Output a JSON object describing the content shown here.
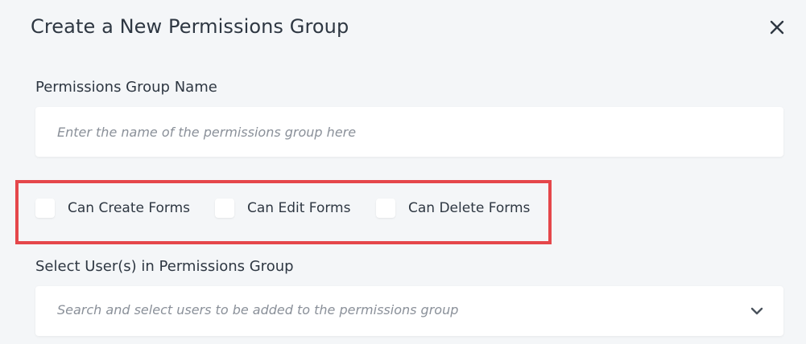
{
  "modal": {
    "title": "Create a New Permissions Group",
    "close_icon": "close-icon"
  },
  "group_name": {
    "label": "Permissions Group Name",
    "placeholder": "Enter the name of the permissions group here",
    "value": ""
  },
  "permissions": {
    "highlight_color": "#e5474b",
    "items": [
      {
        "label": "Can Create Forms",
        "checked": false
      },
      {
        "label": "Can Edit Forms",
        "checked": false
      },
      {
        "label": "Can Delete Forms",
        "checked": false
      }
    ]
  },
  "users": {
    "label": "Select User(s) in Permissions Group",
    "placeholder": "Search and select users to be added to the permissions group",
    "dropdown_icon": "chevron-down-icon"
  }
}
